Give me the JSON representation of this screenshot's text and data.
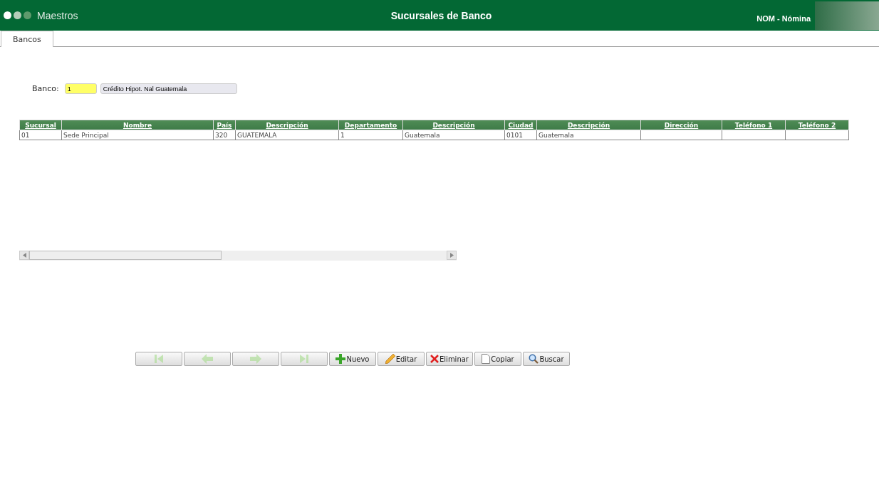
{
  "header": {
    "section": "Maestros",
    "title": "Sucursales de Banco",
    "module": "NOM - Nómina"
  },
  "tabs": [
    {
      "label": "Bancos",
      "selected": true
    }
  ],
  "form": {
    "label": "Banco:",
    "code": "1",
    "description": "Crédito Hipot. Nal Guatemala"
  },
  "table": {
    "columns": [
      "Sucursal",
      "Nombre",
      "País",
      "Descripción",
      "Departamento",
      "Descripción",
      "Ciudad",
      "Descripción",
      "Dirección",
      "Teléfono 1",
      "Teléfono 2"
    ],
    "rows": [
      [
        "01",
        "Sede Principal",
        "320",
        "GUATEMALA",
        "1",
        "Guatemala",
        "0101",
        "Guatemala",
        "",
        "",
        ""
      ]
    ]
  },
  "buttons": [
    {
      "kind": "first",
      "disabled": true
    },
    {
      "kind": "previous",
      "disabled": true
    },
    {
      "kind": "next",
      "disabled": true
    },
    {
      "kind": "last",
      "disabled": true
    },
    {
      "kind": "new",
      "label": "Nuevo",
      "disabled": false
    },
    {
      "kind": "edit",
      "label": "Editar",
      "disabled": false
    },
    {
      "kind": "delete",
      "label": "Eliminar",
      "disabled": false
    },
    {
      "kind": "copy",
      "label": "Copiar",
      "disabled": false
    },
    {
      "kind": "search",
      "label": "Buscar",
      "disabled": false
    }
  ]
}
